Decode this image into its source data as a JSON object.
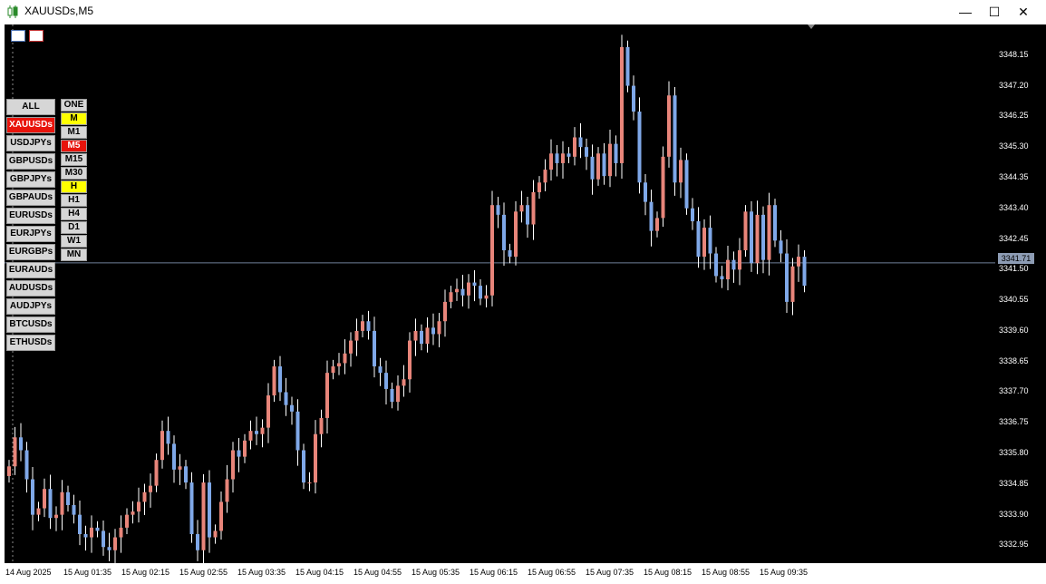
{
  "window": {
    "title": "XAUUSDs,M5"
  },
  "colors": {
    "up": "#e8857a",
    "down": "#7fa8e8",
    "bg": "#000000",
    "active_red": "#e8140c",
    "active_yellow": "#ffff00"
  },
  "symbols": [
    {
      "label": "ALL",
      "state": "normal"
    },
    {
      "label": "XAUUSDs",
      "state": "active"
    },
    {
      "label": "USDJPYs",
      "state": "normal"
    },
    {
      "label": "GBPUSDs",
      "state": "normal"
    },
    {
      "label": "GBPJPYs",
      "state": "normal"
    },
    {
      "label": "GBPAUDs",
      "state": "normal"
    },
    {
      "label": "EURUSDs",
      "state": "normal"
    },
    {
      "label": "EURJPYs",
      "state": "normal"
    },
    {
      "label": "EURGBPs",
      "state": "normal"
    },
    {
      "label": "EURAUDs",
      "state": "normal"
    },
    {
      "label": "AUDUSDs",
      "state": "normal"
    },
    {
      "label": "AUDJPYs",
      "state": "normal"
    },
    {
      "label": "BTCUSDs",
      "state": "normal"
    },
    {
      "label": "ETHUSDs",
      "state": "normal"
    }
  ],
  "timeframes": [
    {
      "label": "ONE",
      "state": "normal"
    },
    {
      "label": "M",
      "state": "yellow"
    },
    {
      "label": "M1",
      "state": "normal"
    },
    {
      "label": "M5",
      "state": "active"
    },
    {
      "label": "M15",
      "state": "normal"
    },
    {
      "label": "M30",
      "state": "normal"
    },
    {
      "label": "H",
      "state": "yellow"
    },
    {
      "label": "H1",
      "state": "normal"
    },
    {
      "label": "H4",
      "state": "normal"
    },
    {
      "label": "D1",
      "state": "normal"
    },
    {
      "label": "W1",
      "state": "normal"
    },
    {
      "label": "MN",
      "state": "normal"
    }
  ],
  "price_axis": [
    "3348.15",
    "3347.20",
    "3346.25",
    "3345.30",
    "3344.35",
    "3343.40",
    "3342.45",
    "3341.50",
    "3340.55",
    "3339.60",
    "3338.65",
    "3337.70",
    "3336.75",
    "3335.80",
    "3334.85",
    "3333.90",
    "3332.95"
  ],
  "current_price": "3341.71",
  "time_axis": [
    "14 Aug 2025",
    "15 Aug 01:35",
    "15 Aug 02:15",
    "15 Aug 02:55",
    "15 Aug 03:35",
    "15 Aug 04:15",
    "15 Aug 04:55",
    "15 Aug 05:35",
    "15 Aug 06:15",
    "15 Aug 06:55",
    "15 Aug 07:35",
    "15 Aug 08:15",
    "15 Aug 08:55",
    "15 Aug 09:35"
  ],
  "chart_data": {
    "type": "candlestick",
    "symbol": "XAUUSDs",
    "timeframe": "M5",
    "ylim": [
      3332.4,
      3349.1
    ],
    "current_price": 3341.71,
    "x": [
      "14 Aug 2025",
      "15 Aug 01:35",
      "15 Aug 02:15",
      "15 Aug 02:55",
      "15 Aug 03:35",
      "15 Aug 04:15",
      "15 Aug 04:55",
      "15 Aug 05:35",
      "15 Aug 06:15",
      "15 Aug 06:55",
      "15 Aug 07:35",
      "15 Aug 08:15",
      "15 Aug 08:55",
      "15 Aug 09:35"
    ],
    "closes": [
      3335.4,
      3336.3,
      3335.9,
      3335.0,
      3333.9,
      3334.1,
      3334.7,
      3333.8,
      3333.9,
      3334.6,
      3334.2,
      3333.9,
      3333.3,
      3333.2,
      3333.5,
      3333.4,
      3332.9,
      3332.8,
      3333.2,
      3333.5,
      3333.9,
      3334.0,
      3334.3,
      3334.6,
      3334.8,
      3335.6,
      3336.5,
      3336.1,
      3335.3,
      3335.4,
      3334.9,
      3333.3,
      3332.8,
      3334.9,
      3333.2,
      3333.4,
      3334.3,
      3335.0,
      3335.9,
      3335.7,
      3336.2,
      3336.5,
      3336.4,
      3336.6,
      3337.6,
      3338.5,
      3337.7,
      3337.3,
      3337.1,
      3335.9,
      3334.9,
      3334.9,
      3336.4,
      3336.9,
      3338.3,
      3338.5,
      3338.6,
      3338.9,
      3339.3,
      3339.6,
      3339.9,
      3339.6,
      3338.5,
      3338.3,
      3337.8,
      3337.4,
      3337.9,
      3338.1,
      3339.3,
      3339.6,
      3339.2,
      3339.7,
      3339.5,
      3339.9,
      3340.5,
      3340.8,
      3340.9,
      3340.7,
      3341.1,
      3341.0,
      3340.6,
      3340.7,
      3343.5,
      3343.2,
      3342.1,
      3341.9,
      3343.3,
      3343.5,
      3342.9,
      3343.9,
      3344.2,
      3344.6,
      3345.1,
      3344.8,
      3345.1,
      3345.0,
      3345.6,
      3345.3,
      3345.0,
      3344.3,
      3345.1,
      3344.4,
      3345.4,
      3344.8,
      3348.4,
      3347.2,
      3346.4,
      3344.2,
      3343.6,
      3342.7,
      3343.1,
      3345.0,
      3346.9,
      3344.2,
      3344.9,
      3343.4,
      3343.0,
      3341.9,
      3342.8,
      3342.0,
      3341.3,
      3341.2,
      3341.8,
      3341.5,
      3342.1,
      3343.3,
      3341.7,
      3343.2,
      3341.8,
      3343.5,
      3342.4,
      3342.0,
      3340.5,
      3341.6,
      3341.9,
      3341.0
    ]
  }
}
